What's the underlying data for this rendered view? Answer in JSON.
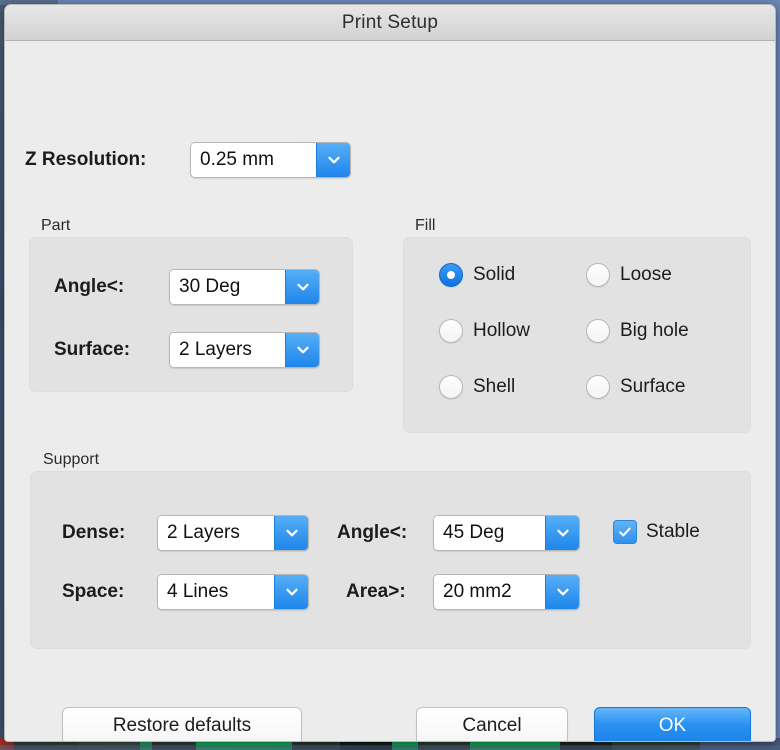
{
  "window": {
    "title": "Print Setup"
  },
  "z_resolution": {
    "label": "Z Resolution:",
    "value": "0.25 mm"
  },
  "part": {
    "title": "Part",
    "angle": {
      "label": "Angle<:",
      "value": "30 Deg"
    },
    "surface": {
      "label": "Surface:",
      "value": "2 Layers"
    }
  },
  "fill": {
    "title": "Fill",
    "options": [
      {
        "label": "Solid",
        "selected": true
      },
      {
        "label": "Loose",
        "selected": false
      },
      {
        "label": "Hollow",
        "selected": false
      },
      {
        "label": "Big hole",
        "selected": false
      },
      {
        "label": "Shell",
        "selected": false
      },
      {
        "label": "Surface",
        "selected": false
      }
    ]
  },
  "support": {
    "title": "Support",
    "dense": {
      "label": "Dense:",
      "value": "2 Layers"
    },
    "space": {
      "label": "Space:",
      "value": "4 Lines"
    },
    "angle": {
      "label": "Angle<:",
      "value": "45 Deg"
    },
    "area": {
      "label": "Area>:",
      "value": "20 mm2"
    },
    "stable": {
      "label": "Stable",
      "checked": true
    }
  },
  "buttons": {
    "restore": "Restore defaults",
    "cancel": "Cancel",
    "ok": "OK"
  },
  "colors": {
    "accent_blue": "#2b92f2",
    "dialog_bg": "#ececec",
    "group_bg": "#e2e2e2"
  }
}
